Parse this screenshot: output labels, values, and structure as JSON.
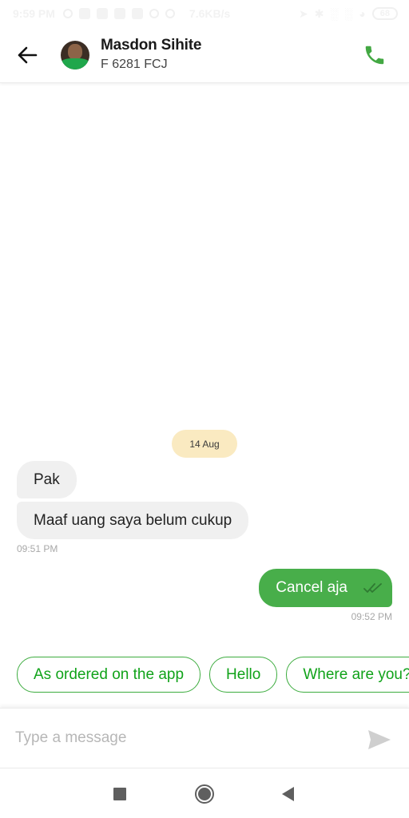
{
  "status_bar": {
    "time": "9:59 PM",
    "network_speed": "7.6KB/s",
    "battery": "68"
  },
  "header": {
    "back_icon": "arrow-left-icon",
    "driver_name": "Masdon Sihite",
    "plate_number": "F 6281 FCJ",
    "call_icon": "phone-icon"
  },
  "colors": {
    "brand_green": "#48ae4a",
    "chip_text_green": "#11a31a",
    "date_chip_bg": "#faeac1",
    "incoming_bubble_bg": "#f0f0f0"
  },
  "chat": {
    "date_separator": "14 Aug",
    "incoming": {
      "messages": [
        "Pak",
        "Maaf uang saya belum cukup"
      ],
      "timestamp": "09:51 PM"
    },
    "outgoing": {
      "messages": [
        "Cancel aja"
      ],
      "status_icon": "double-check-icon",
      "timestamp": "09:52 PM"
    }
  },
  "quick_replies": [
    "As ordered on the app",
    "Hello",
    "Where are you?"
  ],
  "composer": {
    "placeholder": "Type a message",
    "value": "",
    "send_icon": "send-icon"
  },
  "navbar": {
    "recent_icon": "recent-apps-icon",
    "home_icon": "home-icon",
    "back_icon": "back-triangle-icon"
  }
}
